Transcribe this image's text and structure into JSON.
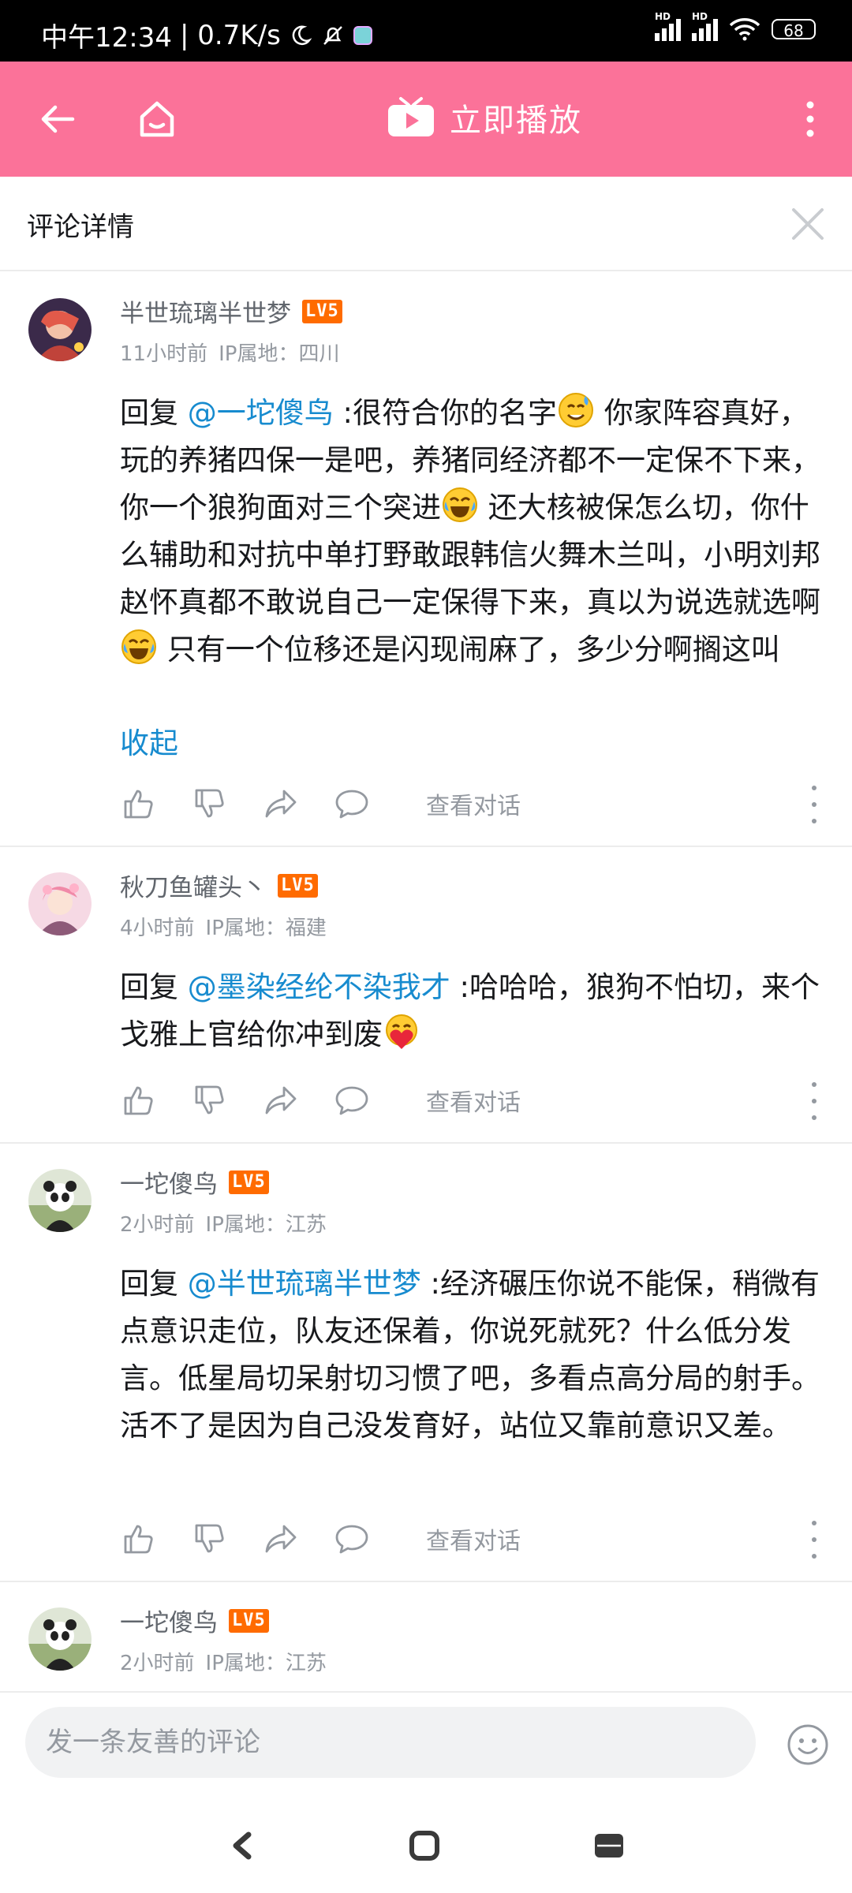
{
  "status_bar": {
    "time": "中午12:34",
    "speed": "| 0.7K/s",
    "hd_label_1": "HD",
    "hd_label_2": "HD",
    "battery": "68"
  },
  "header": {
    "play_label": "立即播放",
    "accent_color": "#fb7299"
  },
  "detail": {
    "title": "评论详情"
  },
  "comments": [
    {
      "user": "半世琉璃半世梦",
      "level": "LV5",
      "time": "11小时前",
      "ip": "IP属地：四川",
      "reply_prefix": "回复 ",
      "mention": "@一坨傻鸟",
      "segments": [
        " :很符合你的名字",
        " 你家阵容真好，玩的养猪四保一是吧，养猪同经济都不一定保不下来，你一个狼狗面对三个突进",
        " 还大核被保怎么切，你什么辅助和对抗中单打野敢跟韩信火舞木兰叫，小明刘邦赵怀真都不敢说自己一定保得下来，真以为说选就选啊",
        " 只有一个位移还是闪现闹麻了，多少分啊搁这叫"
      ],
      "collapse_label": "收起",
      "see_conversation": "查看对话"
    },
    {
      "user": "秋刀鱼罐头丶",
      "level": "LV5",
      "time": "4小时前",
      "ip": "IP属地：福建",
      "reply_prefix": "回复 ",
      "mention": "@墨染经纶不染我才",
      "segments": [
        " :哈哈哈，狼狗不怕切，来个戈雅上官给你冲到废"
      ],
      "see_conversation": "查看对话"
    },
    {
      "user": "一坨傻鸟",
      "level": "LV5",
      "time": "2小时前",
      "ip": "IP属地：江苏",
      "reply_prefix": "回复 ",
      "mention": "@半世琉璃半世梦",
      "segments": [
        " :经济碾压你说不能保，稍微有点意识走位，队友还保着，你说死就死？什么低分发言。低星局切呆射切习惯了吧，多看点高分局的射手。活不了是因为自己没发育好，站位又靠前意识又差。"
      ],
      "see_conversation": "查看对话"
    },
    {
      "user": "一坨傻鸟",
      "level": "LV5",
      "time": "2小时前",
      "ip": "IP属地：江苏"
    }
  ],
  "input": {
    "placeholder": "发一条友善的评论"
  },
  "colors": {
    "mention": "#178bcf",
    "level_badge": "#ff6b00",
    "muted": "#9499a0"
  }
}
